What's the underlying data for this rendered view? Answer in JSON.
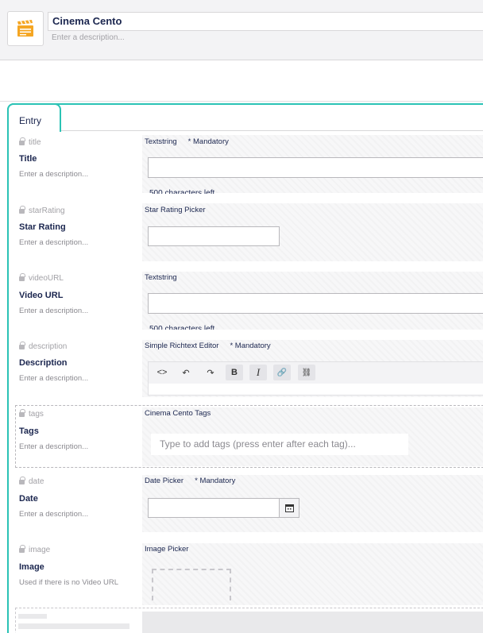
{
  "header": {
    "icon": "clapperboard-icon",
    "name": "Cinema Cento",
    "description_placeholder": "Enter a description..."
  },
  "tabs": [
    {
      "label": "Entry"
    }
  ],
  "properties": [
    {
      "alias": "title",
      "label": "Title",
      "description": "Enter a description...",
      "editor": "Textstring",
      "mandatory": "* Mandatory",
      "footer": "500 characters left"
    },
    {
      "alias": "starRating",
      "label": "Star Rating",
      "description": "Enter a description...",
      "editor": "Star Rating Picker"
    },
    {
      "alias": "videoURL",
      "label": "Video URL",
      "description": "Enter a description...",
      "editor": "Textstring",
      "footer": "500 characters left"
    },
    {
      "alias": "description",
      "label": "Description",
      "description": "Enter a description...",
      "editor": "Simple Richtext Editor",
      "mandatory": "* Mandatory"
    },
    {
      "alias": "tags",
      "label": "Tags",
      "description": "Enter a description...",
      "editor": "Cinema Cento Tags",
      "placeholder": "Type to add tags (press enter after each tag)..."
    },
    {
      "alias": "date",
      "label": "Date",
      "description": "Enter a description...",
      "editor": "Date Picker",
      "mandatory": "* Mandatory"
    },
    {
      "alias": "image",
      "label": "Image",
      "description": "Used if there is no Video URL",
      "editor": "Image Picker"
    }
  ],
  "rte_toolbar": [
    {
      "icon": "code-icon",
      "glyph": "<>"
    },
    {
      "icon": "undo-icon",
      "glyph": "↶"
    },
    {
      "icon": "redo-icon",
      "glyph": "↷"
    },
    {
      "icon": "bold-icon",
      "glyph": "B"
    },
    {
      "icon": "italic-icon",
      "glyph": "I"
    },
    {
      "icon": "link-icon",
      "glyph": "🔗"
    },
    {
      "icon": "unlink-icon",
      "glyph": "⛓"
    }
  ],
  "colors": {
    "accent": "#2bc3b5",
    "text": "#1b264f",
    "muted": "#a2a1a6"
  }
}
